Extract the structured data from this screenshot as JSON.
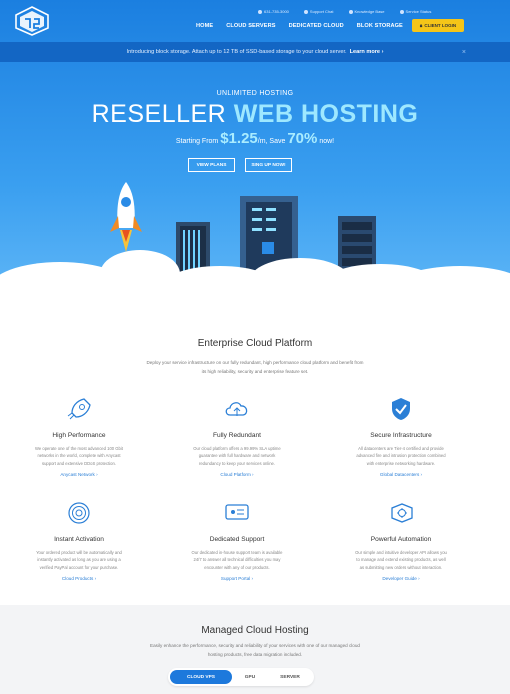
{
  "header": {
    "top_links": [
      "631-735-3000",
      "Support Chat",
      "Knowledge Base",
      "Service Status"
    ],
    "nav": [
      "HOME",
      "CLOUD SERVERS",
      "DEDICATED CLOUD",
      "BLOK STORAGE"
    ],
    "login_label": "CLIENT LOGIN"
  },
  "promo": {
    "text": "Introducing block storage. Attach up to 12 TB of SSD-based storage to your cloud server.",
    "link": "Learn more ›",
    "close": "×"
  },
  "hero": {
    "subtitle": "UNLIMITED HOSTING",
    "title_main": "RESELLER",
    "title_highlight": "WEB HOSTING",
    "price_prefix": "Starting From",
    "price": "$1.25",
    "price_unit": "/m, Save",
    "save_pct": "70%",
    "price_suffix": "now!",
    "btn_plans": "VIEW PLANS",
    "btn_signup": "SING UP NOW!"
  },
  "platform": {
    "title": "Enterprise Cloud Platform",
    "intro_1": "Deploy your service infrastructure on our fully redundant, high performance cloud platform and benefit from",
    "intro_2": "its high reliability, security and enterprise feature set.",
    "features": [
      {
        "icon": "rocket-icon",
        "title": "High Performance",
        "d1": "We operate one of the most advanced 100 Gbit",
        "d2": "networks in the world, complete with Anycast",
        "d3": "support and extensive DDoS protection.",
        "link": "Anycast Network ›"
      },
      {
        "icon": "cloud-upload-icon",
        "title": "Fully Redundant",
        "d1": "Our cloud platform offers a 99.99% SLA uptime",
        "d2": "guarantee with full hardware and network",
        "d3": "redundancy to keep your services online.",
        "link": "Cloud Platform ›"
      },
      {
        "icon": "shield-check-icon",
        "title": "Secure Infrastructure",
        "d1": "All datacenters are Tier-4 certified and provide",
        "d2": "advanced fire and intrusion protection combined",
        "d3": "with enterprise networking hardware.",
        "link": "Global Datacenters ›"
      },
      {
        "icon": "fingerprint-icon",
        "title": "Instant Activation",
        "d1": "Your ordered product will be automatically and",
        "d2": "instantly activated as long as you are using a",
        "d3": "verified PayPal account for your purchase.",
        "link": "Cloud Products ›"
      },
      {
        "icon": "support-chat-icon",
        "title": "Dedicated Support",
        "d1": "Our dedicated in-house support team is available",
        "d2": "24/7 to answer all technical difficulties you may",
        "d3": "encounter with any of our products.",
        "link": "Support Portal ›"
      },
      {
        "icon": "automation-icon",
        "title": "Powerful Automation",
        "d1": "Our simple and intuitive developer API allows you",
        "d2": "to manage and extend existing products, as well",
        "d3": "as submitting new orders without interaction.",
        "link": "Developer Guide ›"
      }
    ]
  },
  "managed": {
    "title": "Managed Cloud Hosting",
    "intro_1": "Easily enhance the performance, security and reliability of your services with one of our managed cloud",
    "intro_2": "hosting products, free data migration included.",
    "tabs": [
      "CLOUD VPS",
      "GPU",
      "SERVER"
    ]
  },
  "colors": {
    "brand_blue": "#1b7fe0",
    "accent_yellow": "#f5c518",
    "link": "#2b7fd6"
  }
}
